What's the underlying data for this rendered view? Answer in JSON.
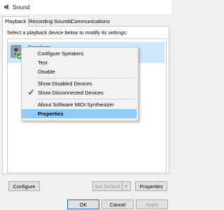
{
  "window": {
    "title": "Sound"
  },
  "tabs": [
    "Playback",
    "Recording",
    "Sounds",
    "Communications"
  ],
  "instruction": "Select a playback device below to modify its settings:",
  "device": {
    "name": "Speakers"
  },
  "menu": {
    "configure": "Configure Speakers",
    "test": "Test",
    "disable": "Disable",
    "show_disabled": "Show Disabled Devices",
    "show_disconnected": "Show Disconnected Devices",
    "about": "About Software MIDI Synthesizer",
    "properties": "Properties"
  },
  "buttons": {
    "configure": "Configure",
    "set_default": "Set Default",
    "properties": "Properties",
    "ok": "OK",
    "cancel": "Cancel",
    "apply": "Apply"
  },
  "colors": {
    "accent": "#0078d7",
    "selected_row": "#cde8ff",
    "menu_highlight": "#91c9f7",
    "default_check": "#2aa52a"
  },
  "icons": {
    "app": "speaker-icon",
    "device": "speaker-device-icon",
    "status": "green-check-icon",
    "menu_check": "checkmark-icon"
  }
}
